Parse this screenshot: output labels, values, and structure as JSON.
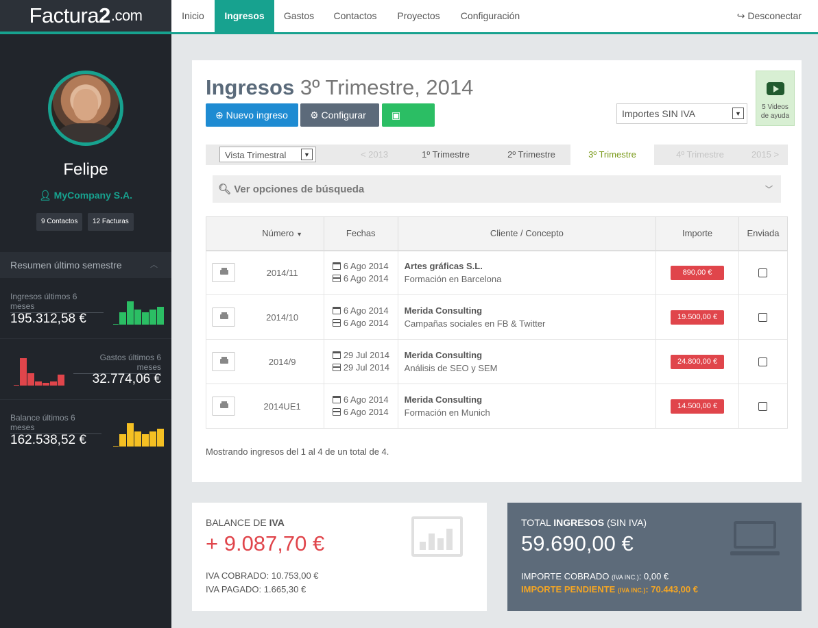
{
  "logo": {
    "prefix": "Factura",
    "number": "2",
    "suffix": ".com"
  },
  "nav": [
    {
      "label": "Inicio",
      "active": false
    },
    {
      "label": "Ingresos",
      "active": true
    },
    {
      "label": "Gastos",
      "active": false
    },
    {
      "label": "Contactos",
      "active": false
    },
    {
      "label": "Proyectos",
      "active": false
    },
    {
      "label": "Configuración",
      "active": false
    }
  ],
  "logout": {
    "label": "Desconectar",
    "icon": "sign-out-icon"
  },
  "sidebar": {
    "user_name": "Felipe",
    "company": "MyCompany S.A.",
    "pills": [
      "9 Contactos",
      "12 Facturas"
    ],
    "summary_title": "Resumen último semestre",
    "stats": [
      {
        "label": "Ingresos últimos 6 meses",
        "value": "195.312,58 €",
        "color": "#2bbe64",
        "bars": [
          0.45,
          0.85,
          0.55,
          0.45,
          0.55,
          0.65
        ]
      },
      {
        "label": "Gastos últimos 6 meses",
        "value": "32.774,06 €",
        "color": "#e0454b",
        "bars": [
          1.0,
          0.45,
          0.15,
          0.1,
          0.15,
          0.4
        ]
      },
      {
        "label": "Balance últimos 6 meses",
        "value": "162.538,52 €",
        "color": "#f5c023",
        "bars": [
          0.45,
          0.85,
          0.55,
          0.45,
          0.55,
          0.65
        ]
      }
    ]
  },
  "page": {
    "title": "Ingresos",
    "subtitle": "3º Trimestre, 2014",
    "buttons": {
      "new": "Nuevo ingreso",
      "configure": "Configurar",
      "excel": "Excel"
    },
    "importes_select": "Importes SIN IVA",
    "videos_label_1": "5 Videos",
    "videos_label_2": "de ayuda",
    "vista_select": "Vista Trimestral",
    "quarters": [
      {
        "label": "< 2013",
        "state": "disabled"
      },
      {
        "label": "1º Trimestre",
        "state": "normal"
      },
      {
        "label": "2º Trimestre",
        "state": "normal"
      },
      {
        "label": "3º Trimestre",
        "state": "active"
      },
      {
        "label": "4º Trimestre",
        "state": "disabled"
      },
      {
        "label": "2015 >",
        "state": "disabled"
      }
    ],
    "search_label": "Ver opciones de búsqueda",
    "columns": [
      "Número",
      "Fechas",
      "Cliente / Concepto",
      "Importe",
      "Enviada"
    ],
    "rows": [
      {
        "number": "2014/11",
        "date1": "6 Ago 2014",
        "date2": "6 Ago 2014",
        "client": "Artes gráficas S.L.",
        "concept": "Formación en Barcelona",
        "amount": "890,00 €"
      },
      {
        "number": "2014/10",
        "date1": "6 Ago 2014",
        "date2": "6 Ago 2014",
        "client": "Merida Consulting",
        "concept": "Campañas sociales en FB & Twitter",
        "amount": "19.500,00 €"
      },
      {
        "number": "2014/9",
        "date1": "29 Jul 2014",
        "date2": "29 Jul 2014",
        "client": "Merida Consulting",
        "concept": "Análisis de SEO y SEM",
        "amount": "24.800,00 €"
      },
      {
        "number": "2014UE1",
        "date1": "6 Ago 2014",
        "date2": "6 Ago 2014",
        "client": "Merida Consulting",
        "concept": "Formación en Munich",
        "amount": "14.500,00 €"
      }
    ],
    "showing_text": "Mostrando ingresos del 1 al 4 de un total de 4."
  },
  "iva": {
    "title_pre": "BALANCE DE ",
    "title_bold": "IVA",
    "value": "+ 9.087,70 €",
    "cobrado": "IVA COBRADO: 10.753,00 €",
    "pagado": "IVA PAGADO: 1.665,30 €"
  },
  "total": {
    "title_pre": "TOTAL ",
    "title_bold": "INGRESOS",
    "title_post": " (SIN IVA)",
    "value": "59.690,00 €",
    "cobrado_label": "IMPORTE COBRADO ",
    "cobrado_small": "(IVA INC.)",
    "cobrado_value": ": 0,00 €",
    "pendiente_label": "IMPORTE PENDIENTE ",
    "pendiente_small": "(IVA INC.)",
    "pendiente_value": ": 70.443,00 €"
  }
}
